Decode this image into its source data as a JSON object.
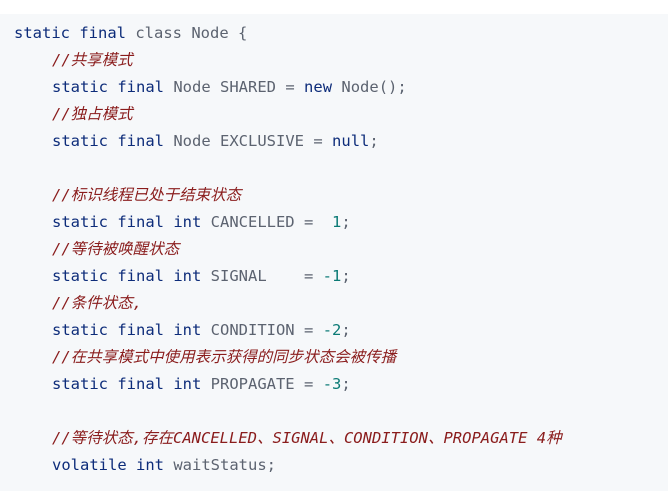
{
  "code": {
    "class_decl": {
      "modifiers": "static final",
      "keyword": "class",
      "name": "Node",
      "open": "{"
    },
    "lines": [
      {
        "comment": "//共享模式"
      },
      {
        "modifiers": "static final",
        "type": "Node",
        "name": "SHARED",
        "eq": "=",
        "value_kw": "new",
        "value_rest": "Node();"
      },
      {
        "comment": "//独占模式"
      },
      {
        "modifiers": "static final",
        "type": "Node",
        "name": "EXCLUSIVE",
        "eq": "=",
        "value_kw": "null",
        "value_rest": ";"
      },
      {
        "comment": "//标识线程已处于结束状态"
      },
      {
        "modifiers": "static final int",
        "name": "CANCELLED",
        "eq": "=",
        "value": "1",
        "end": ";"
      },
      {
        "comment": "//等待被唤醒状态"
      },
      {
        "modifiers": "static final int",
        "name": "SIGNAL",
        "eq": "=",
        "value": "-1",
        "end": ";"
      },
      {
        "comment": "//条件状态,"
      },
      {
        "modifiers": "static final int",
        "name": "CONDITION",
        "eq": "=",
        "value": "-2",
        "end": ";"
      },
      {
        "comment": "//在共享模式中使用表示获得的同步状态会被传播"
      },
      {
        "modifiers": "static final int",
        "name": "PROPAGATE",
        "eq": "=",
        "value": "-3",
        "end": ";"
      },
      {
        "comment": "//等待状态,存在CANCELLED、SIGNAL、CONDITION、PROPAGATE 4种"
      },
      {
        "modifiers": "volatile int",
        "name": "waitStatus",
        "end": ";"
      }
    ]
  }
}
